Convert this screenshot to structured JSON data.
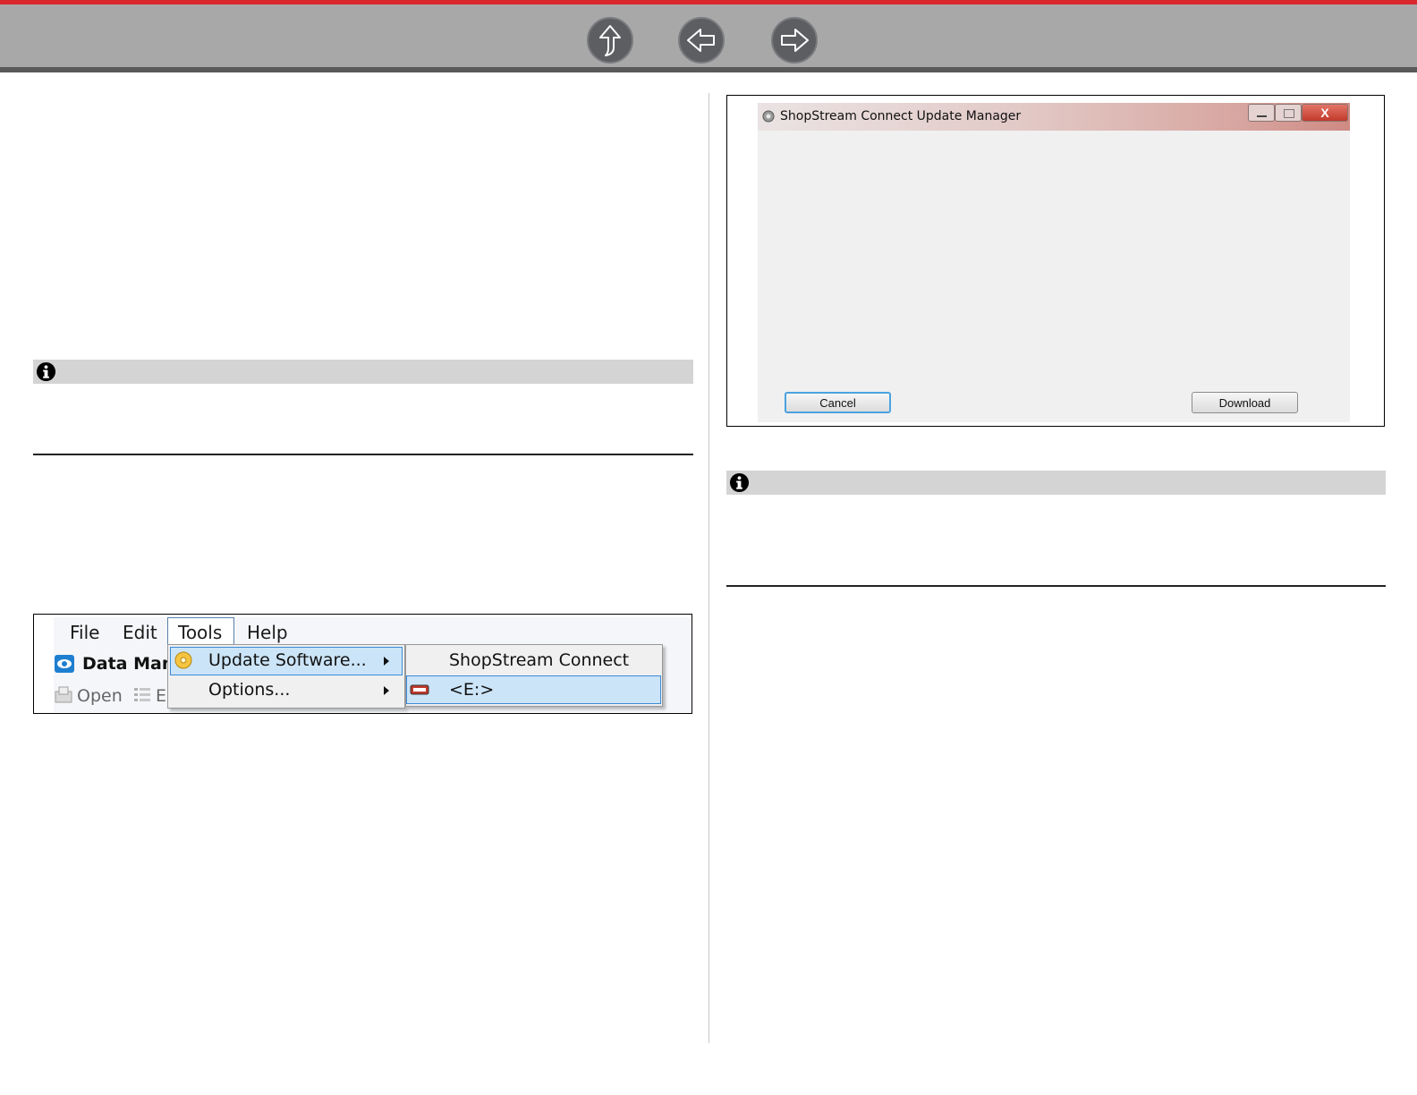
{
  "nav": {
    "up_icon": "up-arrow-icon",
    "back_icon": "left-arrow-icon",
    "forward_icon": "right-arrow-icon",
    "accent_color": "#d9262c"
  },
  "menu_screenshot": {
    "menubar": [
      "File",
      "Edit",
      "Tools",
      "Help"
    ],
    "app_title": "Data Mana",
    "toolbar_open": "Open",
    "toolbar_e": "E",
    "tools_menu": [
      {
        "label": "Update Software...",
        "highlighted": true
      },
      {
        "label": "Options...",
        "highlighted": false
      }
    ],
    "update_submenu": [
      {
        "label": "ShopStream Connect",
        "highlighted": false
      },
      {
        "label": "<E:>",
        "highlighted": true
      }
    ]
  },
  "update_manager": {
    "title": "ShopStream Connect Update Manager",
    "close_label": "X",
    "cancel_label": "Cancel",
    "download_label": "Download"
  }
}
